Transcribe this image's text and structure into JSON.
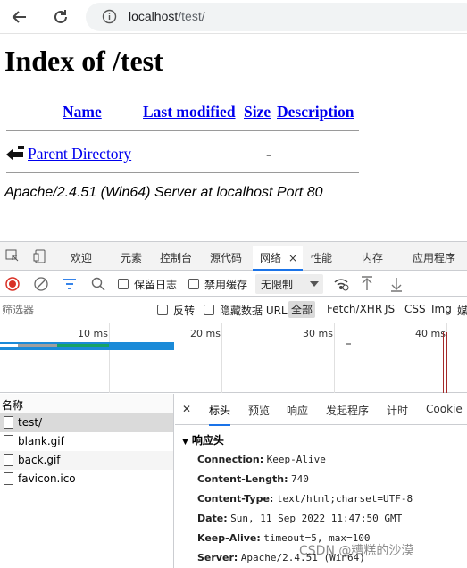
{
  "browser": {
    "url_host": "localhost",
    "url_path": "/test/"
  },
  "page": {
    "title": "Index of /test",
    "columns": [
      "Name",
      "Last modified",
      "Size",
      "Description"
    ],
    "parent_link": "Parent Directory",
    "parent_size": "-",
    "address": "Apache/2.4.51 (Win64) Server at localhost Port 80"
  },
  "devtools": {
    "tabs": [
      "欢迎",
      "元素",
      "控制台",
      "源代码",
      "网络",
      "性能",
      "内存",
      "应用程序"
    ],
    "active_tab": "网络",
    "network_bar": {
      "preserve_log": "保留日志",
      "disable_cache": "禁用缓存",
      "throttle": "无限制"
    },
    "filter_bar": {
      "placeholder": "筛选器",
      "invert": "反转",
      "hide_data_urls": "隐藏数据 URL",
      "types": [
        "全部",
        "Fetch/XHR",
        "JS",
        "CSS",
        "Img",
        "媒"
      ]
    },
    "timeline": {
      "ticks": [
        "10 ms",
        "20 ms",
        "30 ms",
        "40 ms"
      ]
    },
    "request_list": {
      "header": "名称",
      "items": [
        "test/",
        "blank.gif",
        "back.gif",
        "favicon.ico"
      ]
    },
    "detail_tabs": [
      "标头",
      "预览",
      "响应",
      "发起程序",
      "计时",
      "Cookie"
    ],
    "section_title": "响应头",
    "headers": [
      {
        "k": "Connection:",
        "v": "Keep-Alive"
      },
      {
        "k": "Content-Length:",
        "v": "740"
      },
      {
        "k": "Content-Type:",
        "v": "text/html;charset=UTF-8"
      },
      {
        "k": "Date:",
        "v": "Sun, 11 Sep 2022 11:47:50 GMT"
      },
      {
        "k": "Keep-Alive:",
        "v": "timeout=5, max=100"
      },
      {
        "k": "Server:",
        "v": "Apache/2.4.51 (Win64)"
      }
    ]
  },
  "watermark": "CSDN @糟糕的沙漠"
}
